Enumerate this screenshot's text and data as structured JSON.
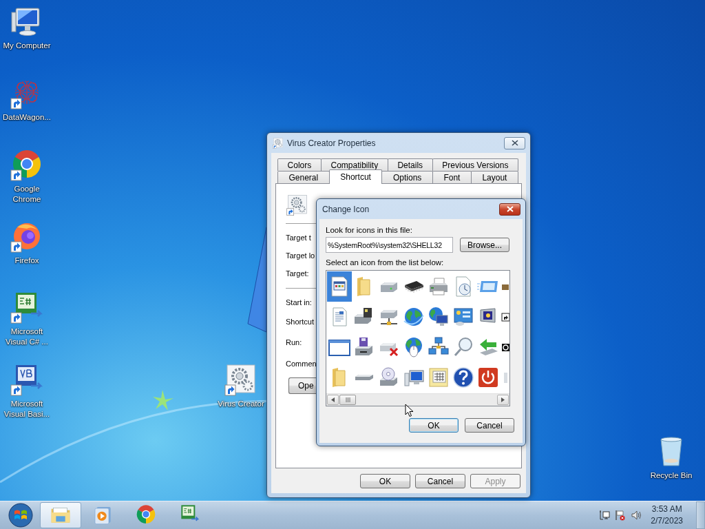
{
  "desktop_icons": [
    {
      "label": "My Computer",
      "kind": "computer",
      "shortcut": false
    },
    {
      "label": "DataWagon...",
      "kind": "datawagon",
      "shortcut": true
    },
    {
      "label": "Google Chrome",
      "kind": "chrome",
      "shortcut": true
    },
    {
      "label": "Firefox",
      "kind": "firefox",
      "shortcut": true
    },
    {
      "label": "Microsoft Visual C# ...",
      "kind": "csharp",
      "shortcut": true
    },
    {
      "label": "Microsoft Visual Basi...",
      "kind": "vb",
      "shortcut": true
    },
    {
      "label": "Virus Creator",
      "kind": "gears",
      "shortcut": true
    },
    {
      "label": "Recycle Bin",
      "kind": "recycle",
      "shortcut": false
    }
  ],
  "properties_window": {
    "title": "Virus Creator Properties",
    "tabs_row_1": [
      {
        "label": "Colors",
        "selected": false
      },
      {
        "label": "Compatibility",
        "selected": false
      },
      {
        "label": "Details",
        "selected": false
      },
      {
        "label": "Previous Versions",
        "selected": false
      }
    ],
    "tabs_row_2": [
      {
        "label": "General",
        "selected": false
      },
      {
        "label": "Shortcut",
        "selected": true
      },
      {
        "label": "Options",
        "selected": false
      },
      {
        "label": "Font",
        "selected": false
      },
      {
        "label": "Layout",
        "selected": false
      }
    ],
    "field_labels": [
      "Target t",
      "Target lo",
      "Target:",
      "Start in:",
      "Shortcut",
      "Run:",
      "Commen"
    ],
    "open_button": "Ope",
    "buttons": [
      {
        "label": "OK",
        "disabled": false
      },
      {
        "label": "Cancel",
        "disabled": false
      },
      {
        "label": "Apply",
        "disabled": true
      }
    ]
  },
  "change_icon_dialog": {
    "title": "Change Icon",
    "file_label": "Look for icons in this file:",
    "file_value": "%SystemRoot%\\system32\\SHELL32",
    "browse_button": "Browse...",
    "list_label": "Select an icon from the list below:",
    "icons": [
      {
        "kind": "program-window",
        "selected": true
      },
      {
        "kind": "folder",
        "selected": false
      },
      {
        "kind": "drive",
        "selected": false
      },
      {
        "kind": "chip",
        "selected": false
      },
      {
        "kind": "printer",
        "selected": false
      },
      {
        "kind": "clock-document",
        "selected": false
      },
      {
        "kind": "screen-frame",
        "selected": false
      },
      {
        "kind": "fragment",
        "selected": false
      },
      {
        "kind": "text-document",
        "selected": false
      },
      {
        "kind": "fax-drive",
        "selected": false
      },
      {
        "kind": "network-drive",
        "selected": false
      },
      {
        "kind": "globe",
        "selected": false
      },
      {
        "kind": "globe-monitor",
        "selected": false
      },
      {
        "kind": "control-panel",
        "selected": false
      },
      {
        "kind": "monitor",
        "selected": false
      },
      {
        "kind": "fragment",
        "selected": false
      },
      {
        "kind": "blank-window",
        "selected": false
      },
      {
        "kind": "floppy-drive",
        "selected": false
      },
      {
        "kind": "drive-cross",
        "selected": false
      },
      {
        "kind": "globe-mouse",
        "selected": false
      },
      {
        "kind": "network",
        "selected": false
      },
      {
        "kind": "magnifier",
        "selected": false
      },
      {
        "kind": "arrow-drive",
        "selected": false
      },
      {
        "kind": "fragment",
        "selected": false
      },
      {
        "kind": "folder",
        "selected": false
      },
      {
        "kind": "flat-drive",
        "selected": false
      },
      {
        "kind": "cd-drive",
        "selected": false
      },
      {
        "kind": "computer",
        "selected": false
      },
      {
        "kind": "calendar-document",
        "selected": false
      },
      {
        "kind": "question",
        "selected": false
      },
      {
        "kind": "power",
        "selected": false
      },
      {
        "kind": "fragment",
        "selected": false
      }
    ],
    "buttons": [
      {
        "label": "OK",
        "default": true
      },
      {
        "label": "Cancel",
        "default": false
      }
    ]
  },
  "taskbar": {
    "items": [
      {
        "kind": "explorer",
        "active": true
      },
      {
        "kind": "media-player",
        "active": false
      },
      {
        "kind": "chrome",
        "active": false
      },
      {
        "kind": "csharp",
        "active": false
      }
    ],
    "time": "3:53 AM",
    "date": "2/7/2023"
  }
}
